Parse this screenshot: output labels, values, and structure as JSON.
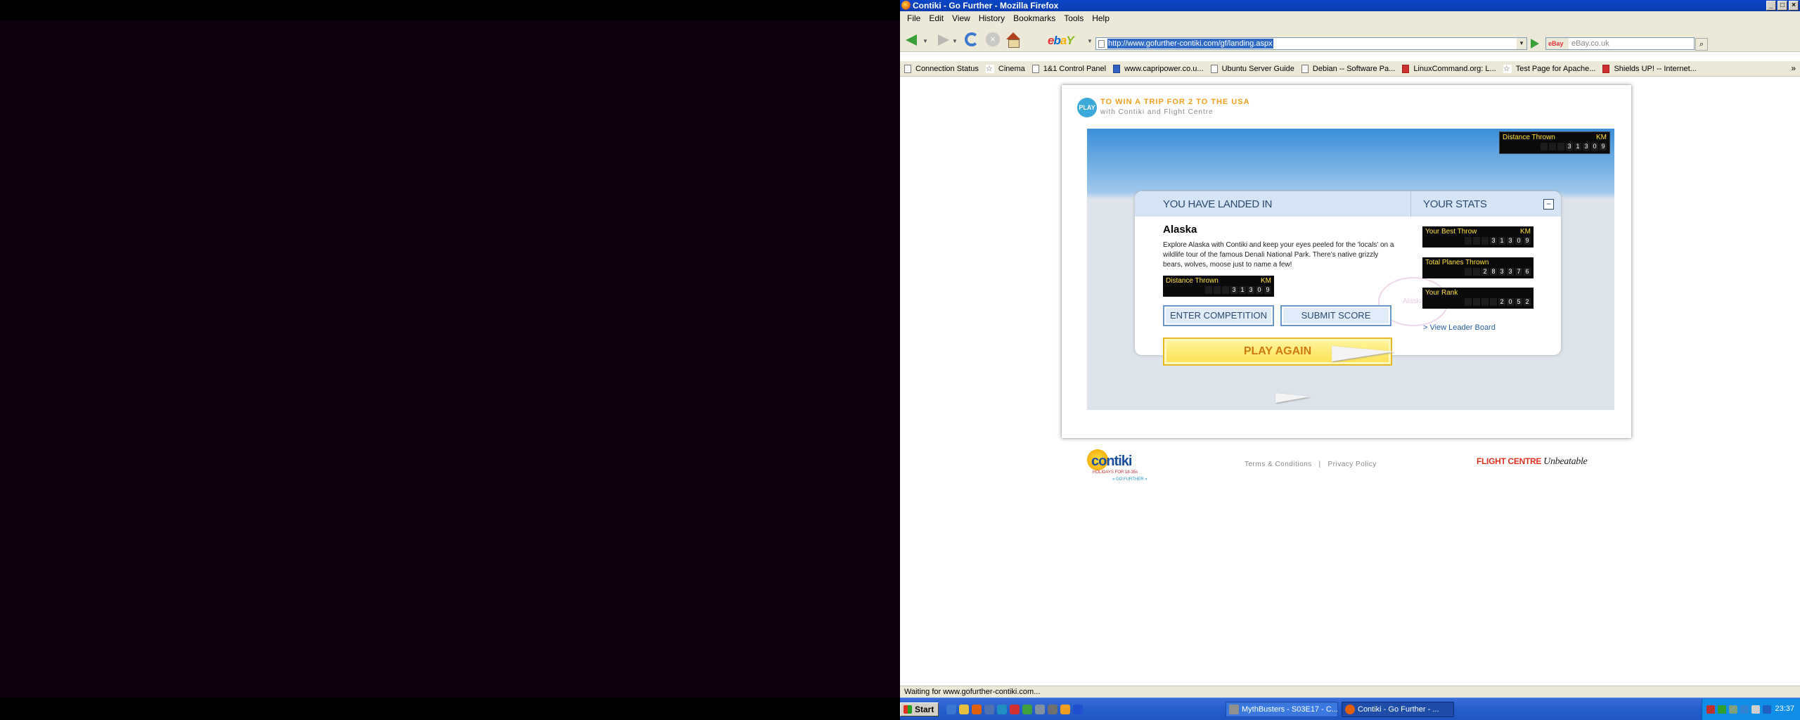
{
  "window": {
    "title": "Contiki - Go Further - Mozilla Firefox",
    "buttons": [
      "_",
      "□",
      "×"
    ]
  },
  "menu": [
    "File",
    "Edit",
    "View",
    "History",
    "Bookmarks",
    "Tools",
    "Help"
  ],
  "nav": {
    "url": "http://www.gofurther-contiki.com/gf/landing.aspx",
    "search_engine": "eBay",
    "search_placeholder": "eBay.co.uk"
  },
  "bookmarks": [
    {
      "label": "Connection Status",
      "icon": "page-icon"
    },
    {
      "label": "Cinema",
      "icon": "star-icon"
    },
    {
      "label": "1&1 Control Panel",
      "icon": "page-icon"
    },
    {
      "label": "www.capripower.co.u...",
      "icon": "blue-icon"
    },
    {
      "label": "Ubuntu Server Guide",
      "icon": "page-icon"
    },
    {
      "label": "Debian -- Software Pa...",
      "icon": "page-icon"
    },
    {
      "label": "LinuxCommand.org: L...",
      "icon": "page-icon"
    },
    {
      "label": "Test Page for Apache...",
      "icon": "star-icon"
    },
    {
      "label": "Shields UP! -- Internet...",
      "icon": "red-icon"
    }
  ],
  "promo": {
    "badge": "PLAY",
    "title": "TO WIN A TRIP FOR 2 TO THE USA",
    "subtitle": "with Contiki and Flight Centre"
  },
  "game": {
    "distance_label": "Distance Thrown",
    "unit": "KM",
    "distance_digits": [
      "",
      "",
      "",
      "3",
      "1",
      "3",
      "0",
      "9"
    ],
    "landed_header": "YOU HAVE LANDED IN",
    "stats_header": "YOUR STATS",
    "collapse": "−",
    "location": "Alaska",
    "description": "Explore Alaska with Contiki and keep your eyes peeled for the 'locals' on a wildlife tour of the famous Denali National Park. There's native grizzly bears, wolves, moose just to name a few!",
    "enter_label": "ENTER COMPETITION",
    "submit_label": "SUBMIT SCORE",
    "play_again_label": "PLAY AGAIN",
    "best_throw_label": "Your Best Throw",
    "best_throw_digits": [
      "",
      "",
      "",
      "3",
      "1",
      "3",
      "0",
      "9"
    ],
    "planes_label": "Total Planes Thrown",
    "planes_digits": [
      "",
      "",
      "2",
      "8",
      "3",
      "3",
      "7",
      "6"
    ],
    "rank_label": "Your Rank",
    "rank_digits": [
      "",
      "",
      "",
      "",
      "2",
      "0",
      "5",
      "2"
    ],
    "leader_link": "> View Leader Board"
  },
  "footer": {
    "contiki": "contiki",
    "contiki_tag": "HOLIDAYS FOR 18-35s",
    "contiki_tag2": "» GO FURTHER »",
    "terms": "Terms & Conditions",
    "sep": "|",
    "privacy": "Privacy Policy",
    "flight_centre": "FLIGHT CENTRE",
    "unbeatable": "Unbeatable"
  },
  "status": "Waiting for www.gofurther-contiki.com...",
  "taskbar": {
    "start": "Start",
    "tasks": [
      "MythBusters - S03E17 - C...",
      "Contiki - Go Further - ..."
    ],
    "clock": "23:37"
  }
}
